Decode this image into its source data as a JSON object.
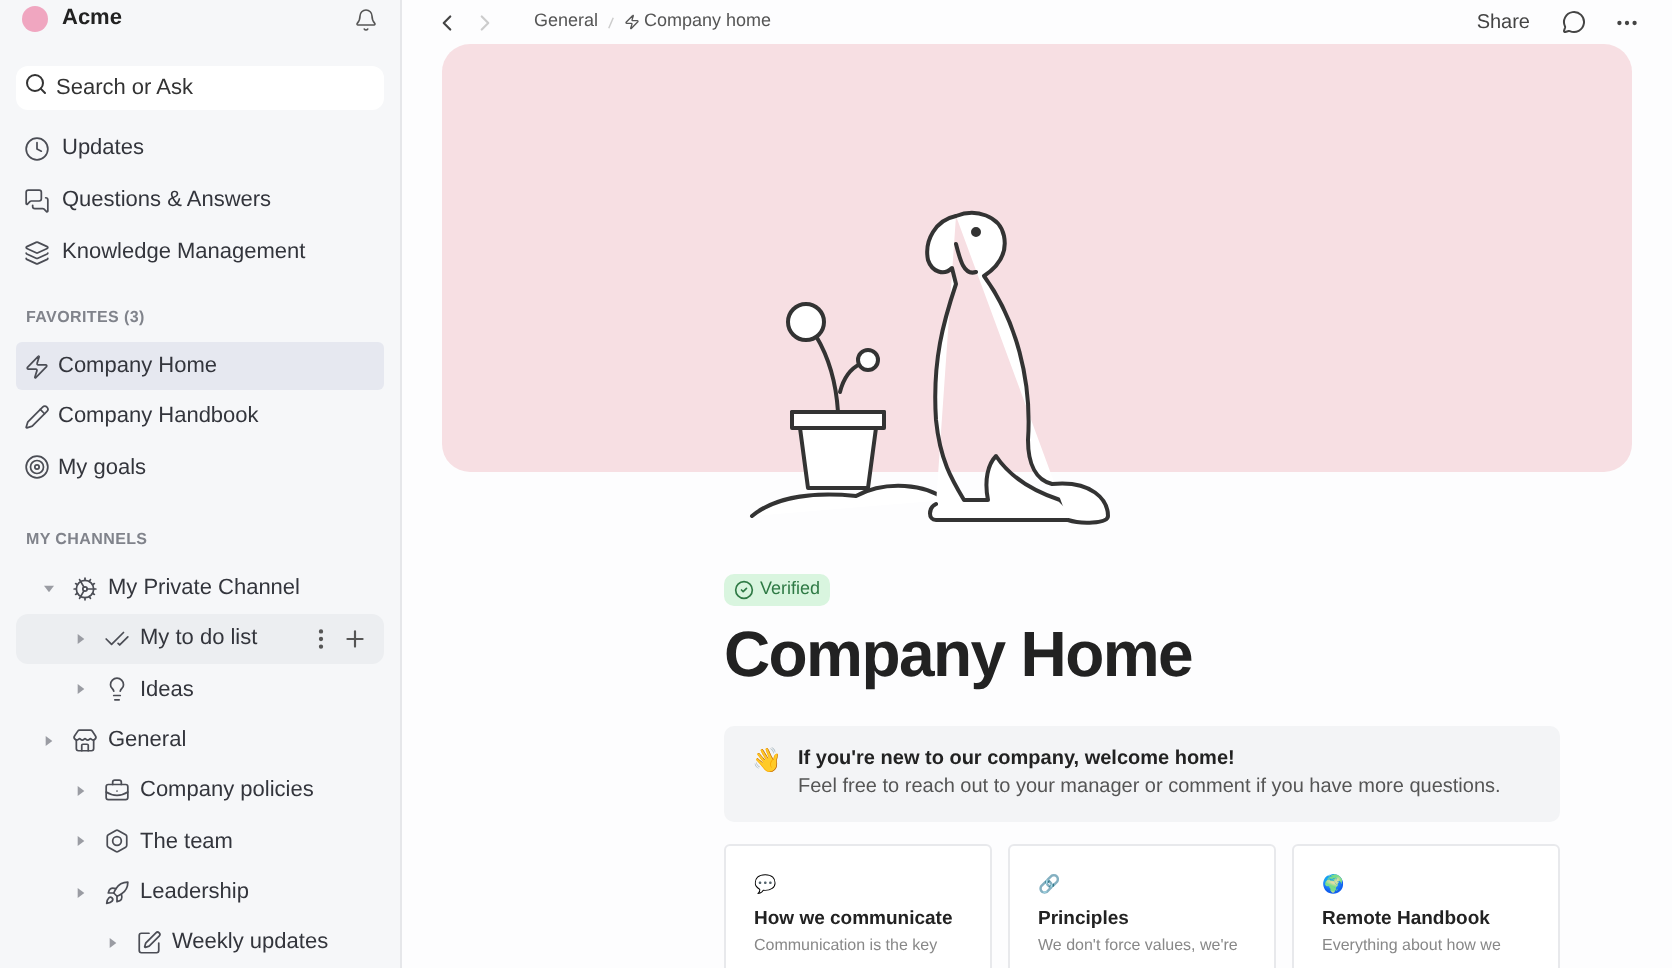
{
  "workspace": {
    "name": "Acme"
  },
  "search": {
    "placeholder": "Search or Ask"
  },
  "nav": [
    {
      "label": "Updates"
    },
    {
      "label": "Questions & Answers"
    },
    {
      "label": "Knowledge Management"
    }
  ],
  "favorites": {
    "heading": "FAVORITES (3)",
    "items": [
      {
        "label": "Company Home",
        "selected": true
      },
      {
        "label": "Company Handbook",
        "selected": false
      },
      {
        "label": "My goals",
        "selected": false
      }
    ]
  },
  "channels": {
    "heading": "MY CHANNELS",
    "items": [
      {
        "label": "My Private Channel",
        "expanded": true,
        "hovered": false,
        "children": [
          {
            "label": "My to do list",
            "expanded": false,
            "hovered": true
          },
          {
            "label": "Ideas",
            "expanded": false,
            "hovered": false
          }
        ]
      },
      {
        "label": "General",
        "expanded": false,
        "hovered": false,
        "children": [
          {
            "label": "Company policies",
            "expanded": false,
            "hovered": false
          },
          {
            "label": "The team",
            "expanded": false,
            "hovered": false
          },
          {
            "label": "Leadership",
            "expanded": false,
            "hovered": false,
            "children": [
              {
                "label": "Weekly updates",
                "expanded": false,
                "hovered": false
              }
            ]
          }
        ]
      }
    ]
  },
  "breadcrumb": [
    "General",
    "Company home"
  ],
  "toolbar": {
    "share": "Share"
  },
  "page": {
    "badge": "Verified",
    "title": "Company Home",
    "callout": {
      "emoji": "👋",
      "title": "If you're new to our company, welcome home!",
      "text": "Feel free to reach out to your manager or comment if you have more questions."
    },
    "cards": [
      {
        "emoji": "💬",
        "title": "How we communicate",
        "text": "Communication is the key"
      },
      {
        "emoji": "🔗",
        "title": "Principles",
        "text": "We don't force values, we're"
      },
      {
        "emoji": "🌍",
        "title": "Remote Handbook",
        "text": "Everything about how we"
      }
    ]
  }
}
